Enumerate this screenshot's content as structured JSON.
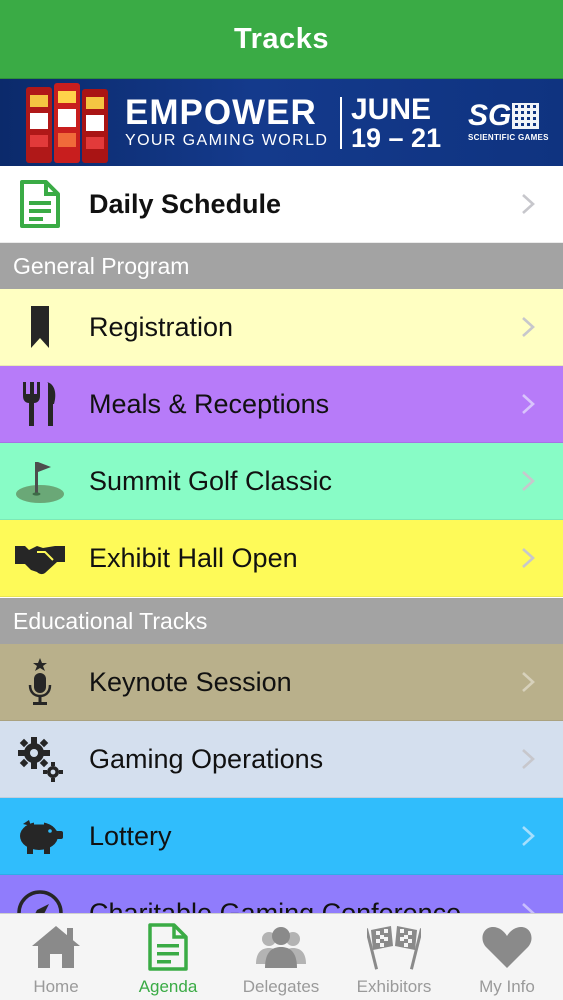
{
  "header": {
    "title": "Tracks"
  },
  "banner": {
    "headline": "EMPOWER",
    "tagline": "YOUR GAMING WORLD",
    "month": "JUNE",
    "dates": "19 – 21",
    "brand_mark": "SG",
    "brand_name": "SCIENTIFIC GAMES"
  },
  "daily": {
    "label": "Daily Schedule",
    "icon": "document-icon",
    "color": "#ffffff"
  },
  "sections": [
    {
      "title": "General Program"
    },
    {
      "title": "Educational Tracks"
    }
  ],
  "general_items": [
    {
      "label": "Registration",
      "icon": "bookmark-icon",
      "color": "#ffffc2"
    },
    {
      "label": "Meals & Receptions",
      "icon": "fork-knife-icon",
      "color": "#b77bf9"
    },
    {
      "label": "Summit Golf Classic",
      "icon": "golf-icon",
      "color": "#88fcc6"
    },
    {
      "label": "Exhibit Hall Open",
      "icon": "handshake-icon",
      "color": "#fefa58"
    }
  ],
  "educational_items": [
    {
      "label": "Keynote Session",
      "icon": "microphone-icon",
      "color": "#b9b08b"
    },
    {
      "label": "Gaming Operations",
      "icon": "gears-icon",
      "color": "#d4dfee"
    },
    {
      "label": "Lottery",
      "icon": "piggy-bank-icon",
      "color": "#30bdfc"
    },
    {
      "label": "Charitable Gaming Conference",
      "icon": "compass-icon",
      "color": "#907cfc"
    }
  ],
  "tabs": [
    {
      "label": "Home",
      "icon": "house-icon",
      "active": false
    },
    {
      "label": "Agenda",
      "icon": "document-icon",
      "active": true
    },
    {
      "label": "Delegates",
      "icon": "people-icon",
      "active": false
    },
    {
      "label": "Exhibitors",
      "icon": "checkered-flags-icon",
      "active": false
    },
    {
      "label": "My Info",
      "icon": "heart-icon",
      "active": false
    }
  ],
  "colors": {
    "accent": "#3aab45",
    "section": "#a3a3a3",
    "tab_inactive": "#9a9a9a"
  }
}
